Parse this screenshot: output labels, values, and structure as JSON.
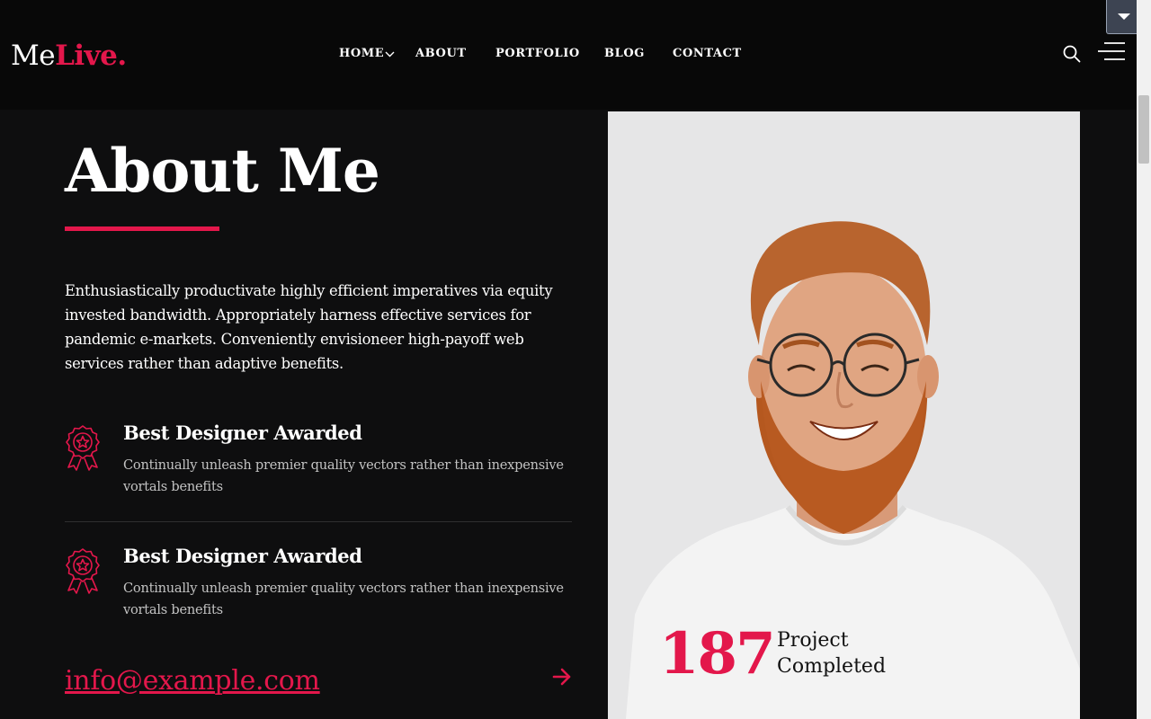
{
  "brand": {
    "name_part1": "Me",
    "name_part2": "Live",
    "name_dot": ".",
    "accent_color": "#e3174b"
  },
  "nav": {
    "items": [
      {
        "label": "HOME",
        "has_dropdown": true
      },
      {
        "label": "ABOUT"
      },
      {
        "label": "PORTFOLIO"
      },
      {
        "label": "BLOG"
      },
      {
        "label": "CONTACT"
      }
    ],
    "icons": [
      "search-icon",
      "hamburger-menu-icon",
      "chevron-down-icon"
    ]
  },
  "about": {
    "title": "About Me",
    "intro": "Enthusiastically productivate highly efficient imperatives via equity invested bandwidth. Appropriately harness effective services for pandemic e-markets. Conveniently envisioneer high-payoff web services rather than adaptive benefits.",
    "awards": [
      {
        "icon": "award-ribbon-icon",
        "title": "Best Designer Awarded",
        "description": "Continually unleash premier quality vectors rather than inexpensive vortals benefits"
      },
      {
        "icon": "award-ribbon-icon",
        "title": "Best Designer Awarded",
        "description": "Continually unleash premier quality vectors rather than inexpensive vortals benefits"
      }
    ],
    "email": "info@example.com"
  },
  "stat": {
    "number": "187",
    "label": "Project Completed"
  },
  "colors": {
    "background": "#0e0e0f",
    "header": "#080808",
    "accent": "#e3174b",
    "photo_bg": "#e6e6e7"
  }
}
